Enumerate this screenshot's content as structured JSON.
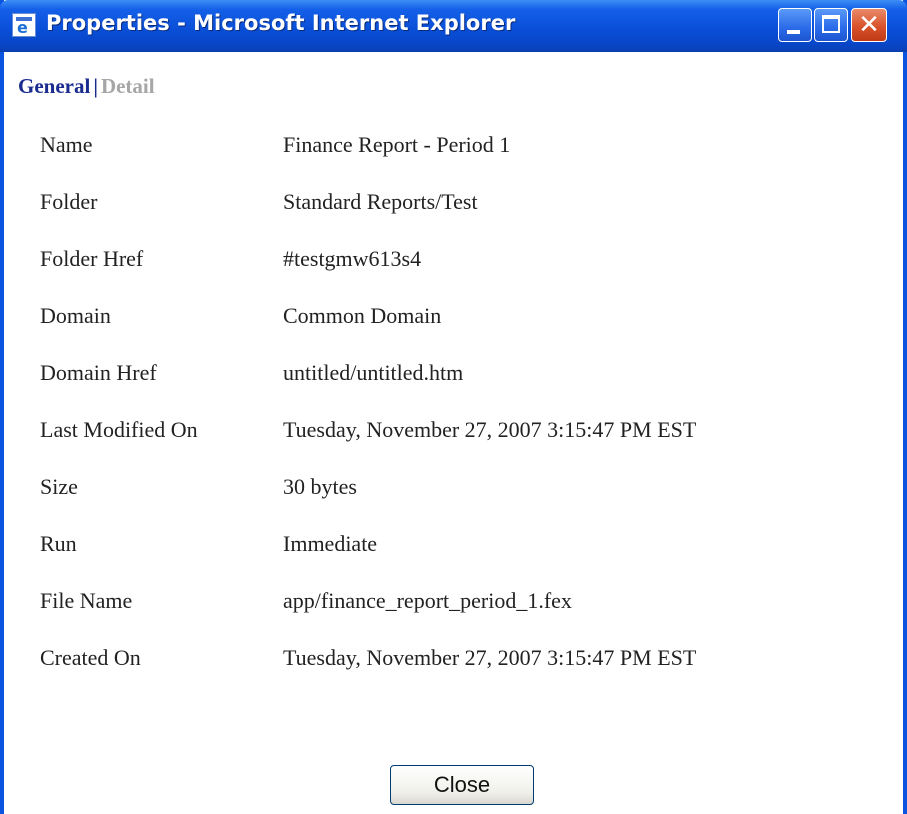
{
  "window": {
    "title": "Properties - Microsoft Internet Explorer",
    "icon": "ie-page-icon",
    "controls": [
      "minimize-icon",
      "maximize-icon",
      "close-icon"
    ]
  },
  "tabs": {
    "general": "General",
    "separator": "|",
    "detail": "Detail",
    "selected": "General"
  },
  "properties": [
    {
      "label": "Name",
      "value": "Finance Report - Period 1"
    },
    {
      "label": "Folder",
      "value": "Standard Reports/Test"
    },
    {
      "label": "Folder Href",
      "value": "#testgmw613s4"
    },
    {
      "label": "Domain",
      "value": "Common Domain"
    },
    {
      "label": "Domain Href",
      "value": "untitled/untitled.htm"
    },
    {
      "label": "Last Modified On",
      "value": "Tuesday, November 27, 2007 3:15:47 PM EST"
    },
    {
      "label": "Size",
      "value": "30 bytes"
    },
    {
      "label": "Run",
      "value": "Immediate"
    },
    {
      "label": "File Name",
      "value": "app/finance_report_period_1.fex"
    },
    {
      "label": "Created On",
      "value": "Tuesday, November 27, 2007 3:15:47 PM EST"
    }
  ],
  "buttons": {
    "close": "Close"
  },
  "colors": {
    "titlebar": "#0a4fd8",
    "tab_active": "#1a2c8e",
    "tab_inactive": "#a6a6a6",
    "close_control": "#d9522b"
  }
}
